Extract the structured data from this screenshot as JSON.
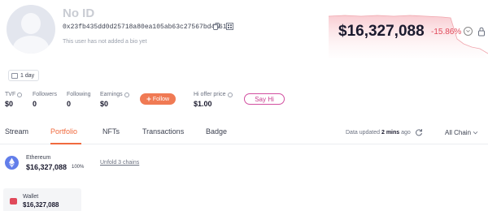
{
  "profile": {
    "name": "No ID",
    "address": "0x23fb435dd0d25718a80ea105ab63c27567bd4661",
    "bio": "This user has not added a bio yet",
    "account_age": "1 day"
  },
  "net_worth": {
    "value": "$16,327,088",
    "change": "-15.86%"
  },
  "stats": [
    {
      "label": "TVF",
      "value": "$0",
      "info": true
    },
    {
      "label": "Followers",
      "value": "0",
      "info": false
    },
    {
      "label": "Following",
      "value": "0",
      "info": false
    },
    {
      "label": "Earnings",
      "value": "$0",
      "info": true
    }
  ],
  "follow_button": "Follow",
  "hi_offer": {
    "label": "Hi offer price",
    "value": "$1.00"
  },
  "say_hi_button": "Say Hi",
  "tabs": [
    "Stream",
    "Portfolio",
    "NFTs",
    "Transactions",
    "Badge"
  ],
  "active_tab": "Portfolio",
  "data_updated": {
    "prefix": "Data updated",
    "time": "2 mins",
    "suffix": "ago"
  },
  "chain_select": "All Chain",
  "chain_row": {
    "name": "Ethereum",
    "value": "$16,327,088",
    "percent": "100%",
    "unfold_label": "Unfold 3 chains"
  },
  "wallet": {
    "label": "Wallet",
    "value": "$16,327,088"
  },
  "colors": {
    "accent": "#f06a3e",
    "negative": "#e0495a",
    "say_hi": "#c8398e",
    "ethereum": "#627eea"
  }
}
